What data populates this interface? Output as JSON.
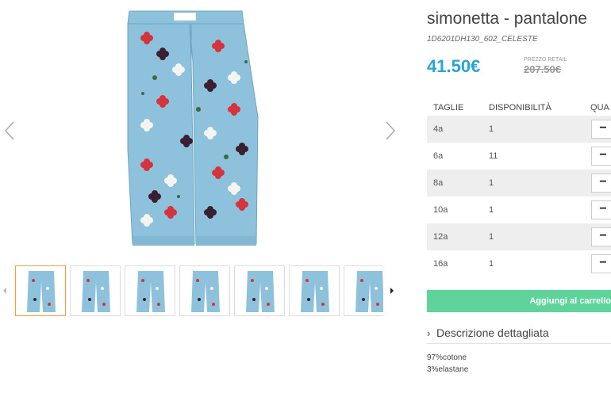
{
  "product": {
    "title": "simonetta - pantalone",
    "sku": "1D6201DH130_602_CELESTE",
    "price": "41.50€",
    "retail_label": "PREZZO RETAIL",
    "retail_price": "207.50€"
  },
  "gallery": {
    "thumbnail_count": 7,
    "active_index": 0,
    "colors": {
      "fabric": "#8ec2dc",
      "flower_red": "#d6343c",
      "flower_white": "#f4f4f0",
      "flower_dark": "#3a2030",
      "leaf": "#3f6a3a",
      "active_border": "#f0a040"
    }
  },
  "sizes": {
    "headers": {
      "size": "TAGLIE",
      "availability": "DISPONIBILITÀ",
      "quantity": "QUA"
    },
    "rows": [
      {
        "size": "4a",
        "availability": "1"
      },
      {
        "size": "6a",
        "availability": "11"
      },
      {
        "size": "8a",
        "availability": "1"
      },
      {
        "size": "10a",
        "availability": "1"
      },
      {
        "size": "12a",
        "availability": "1"
      },
      {
        "size": "16a",
        "availability": "1"
      }
    ],
    "minus_symbol": "−"
  },
  "cart": {
    "add_label": "Aggiungi al carrello",
    "color": "#5ed39a"
  },
  "description": {
    "toggle_label": "Descrizione dettagliata",
    "chevron": "›",
    "composition": [
      "97%cotone",
      "3%elastane"
    ]
  },
  "icons": {
    "prev": "chevron-left-icon",
    "next": "chevron-right-icon",
    "thumb_prev": "caret-left-icon",
    "thumb_next": "caret-right-icon"
  }
}
